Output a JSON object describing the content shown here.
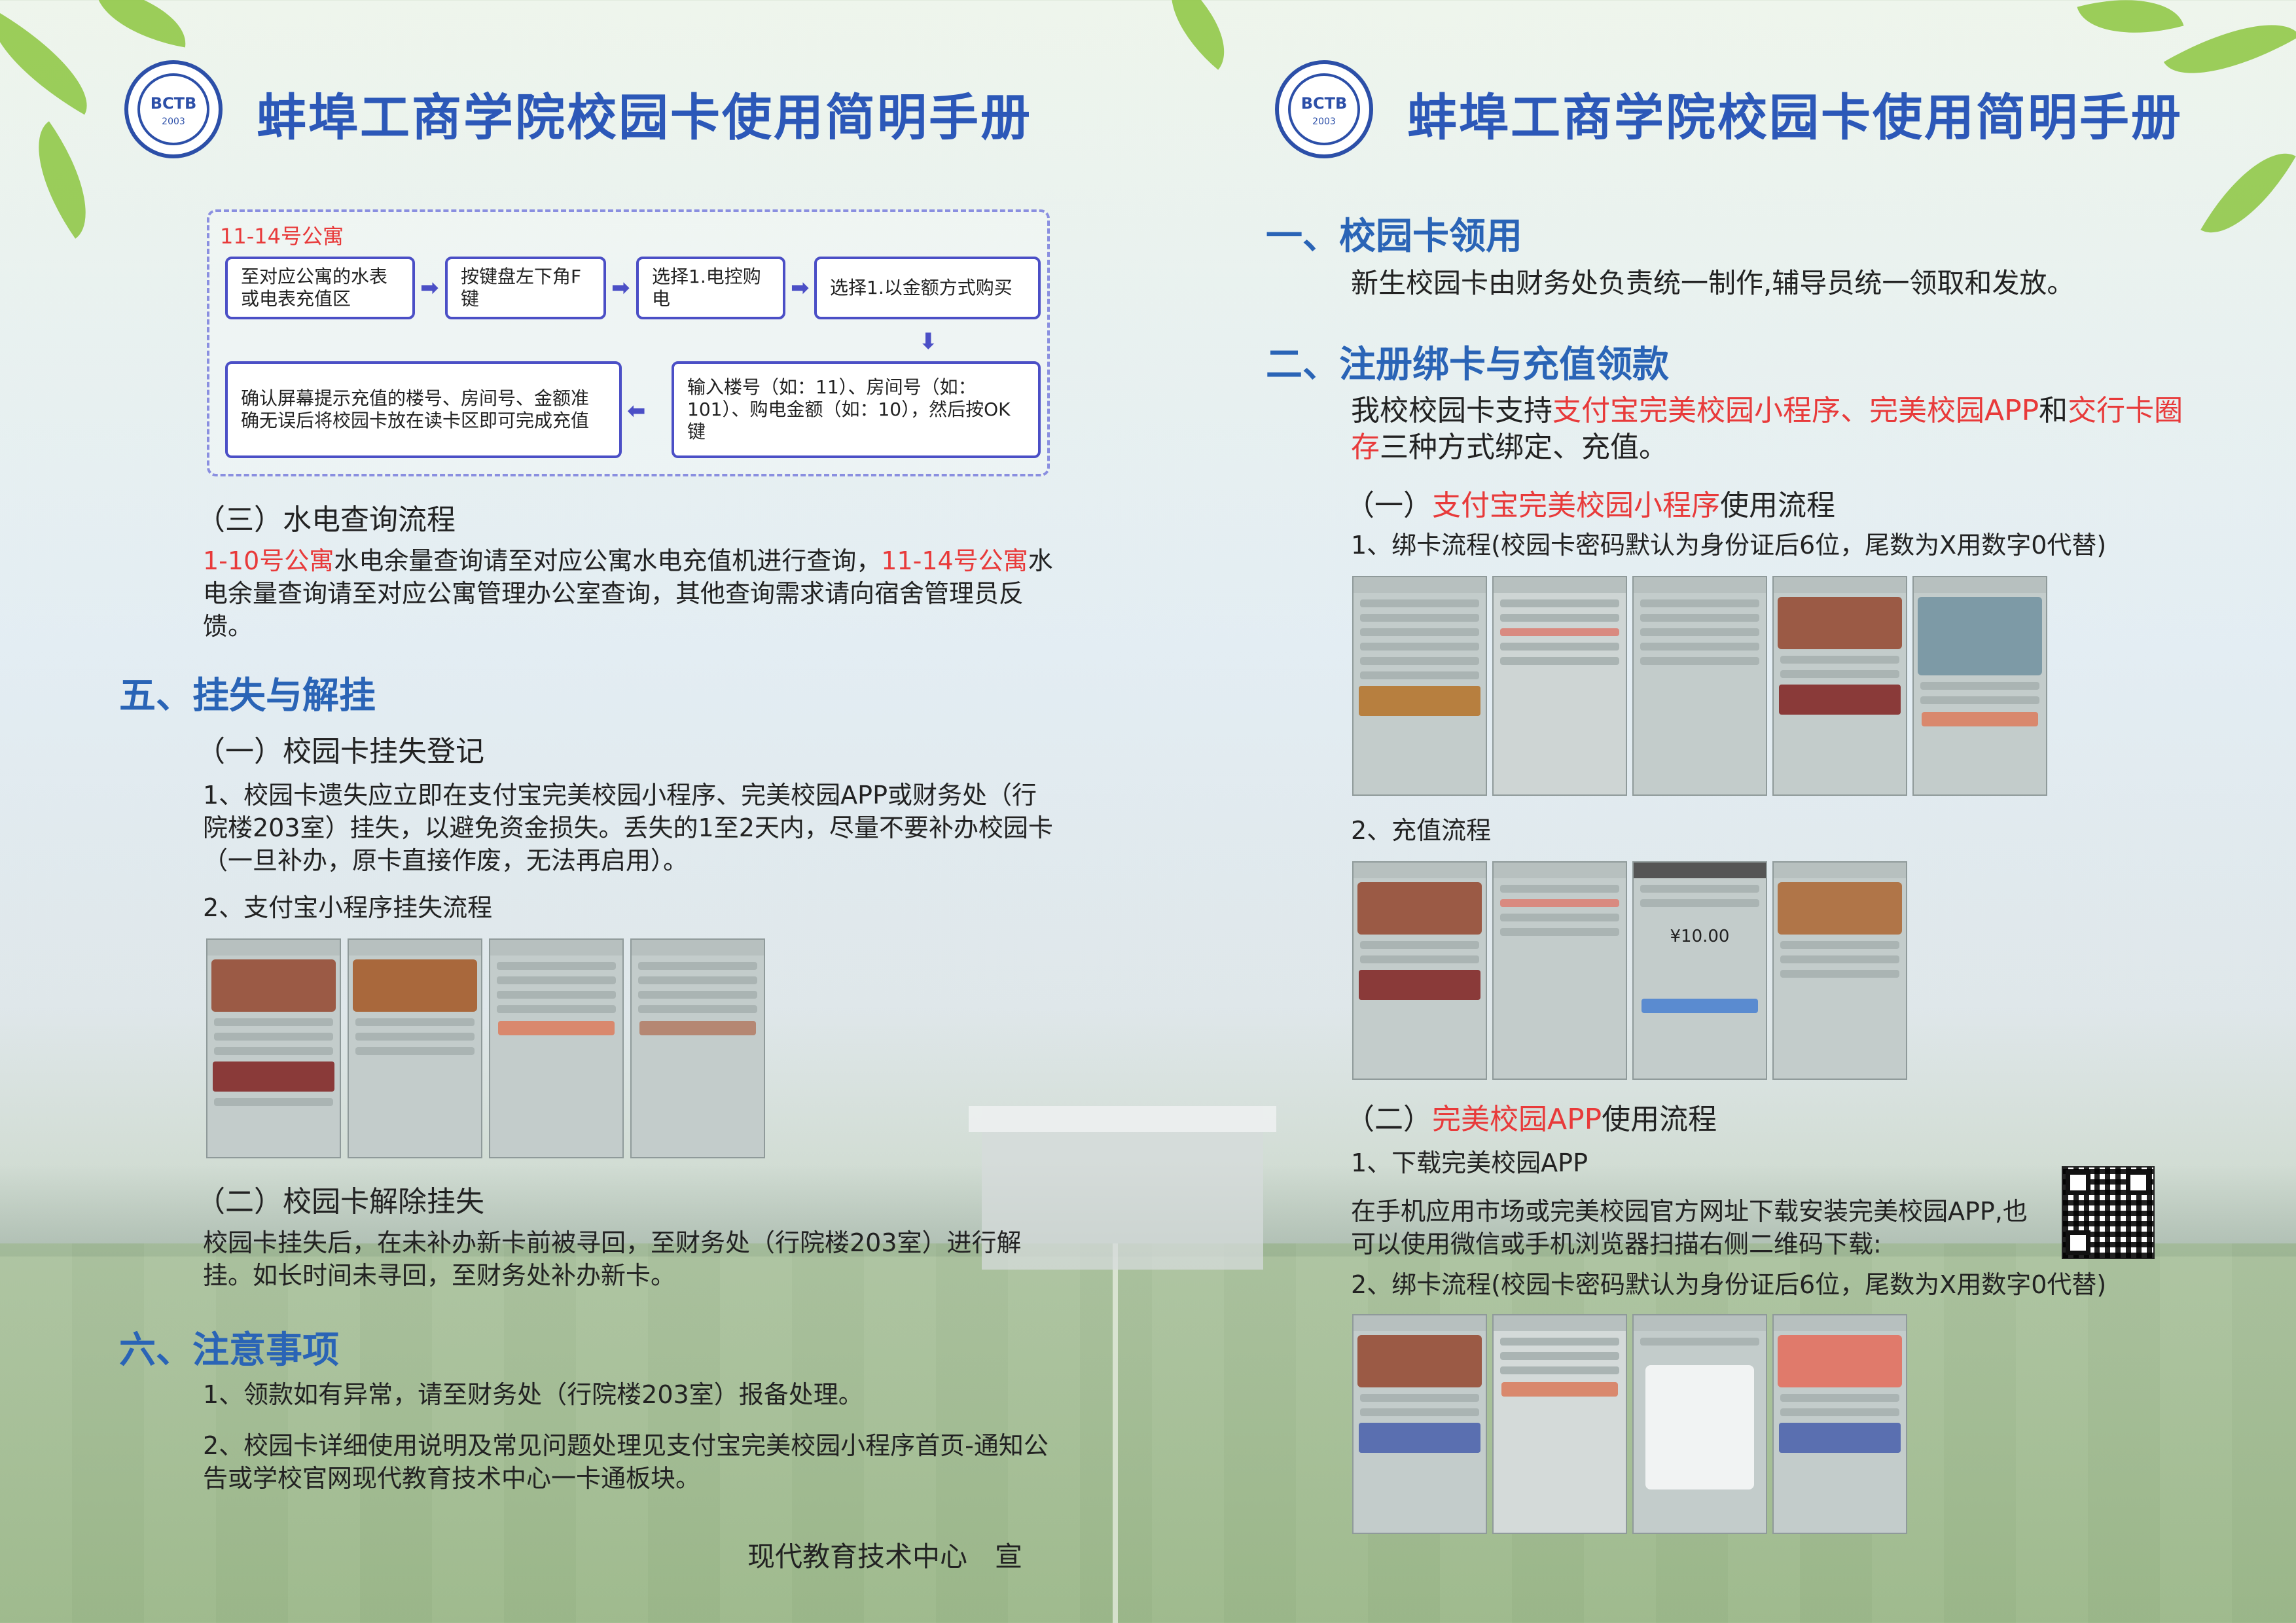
{
  "header": {
    "title": "蚌埠工商学院校园卡使用简明手册",
    "logo_text": "BCTB",
    "logo_year": "2003"
  },
  "left": {
    "flow": {
      "title": "11-14号公寓",
      "steps": [
        "至对应公寓的水表或电表充值区",
        "按键盘左下角F键",
        "选择1.电控购电",
        "选择1.以金额方式购买",
        "输入楼号（如：11）、房间号（如：101）、购电金额（如：10），然后按OK键",
        "确认屏幕提示充值的楼号、房间号、金额准确无误后将校园卡放在读卡区即可完成充值"
      ]
    },
    "s3_title": "（三）水电查询流程",
    "s3_red1": "1-10号公寓",
    "s3_text1": "水电余量查询请至对应公寓水电充值机进行查询，",
    "s3_red2": "11-14号公寓",
    "s3_text2": "水电余量查询请至对应公寓管理办公室查询，其他查询需求请向宿舍管理员反馈。",
    "s5_title": "五、挂失与解挂",
    "s5_sub1": "（一）校园卡挂失登记",
    "s5_p1": "1、校园卡遗失应立即在支付宝完美校园小程序、完美校园APP或财务处（行院楼203室）挂失，以避免资金损失。丢失的1至2天内，尽量不要补办校园卡（一旦补办，原卡直接作废，无法再启用）。",
    "s5_p2": "2、支付宝小程序挂失流程",
    "s5_sub2": "（二）校园卡解除挂失",
    "s5_p3": "校园卡挂失后，在未补办新卡前被寻回，至财务处（行院楼203室）进行解挂。如长时间未寻回，至财务处补办新卡。",
    "s6_title": "六、注意事项",
    "s6_p1": "1、领款如有异常，请至财务处（行院楼203室）报备处理。",
    "s6_p2": "2、校园卡详细使用说明及常见问题处理见支付宝完美校园小程序首页-通知公告或学校官网现代教育技术中心一卡通板块。",
    "sign": "现代教育技术中心　宣"
  },
  "right": {
    "s1_title": "一、校园卡领用",
    "s1_p": "新生校园卡由财务处负责统一制作,辅导员统一领取和发放。",
    "s2_title": "二、注册绑卡与充值领款",
    "s2_a": "我校校园卡支持",
    "s2_red1": "支付宝完美校园小程序、完美校园APP",
    "s2_b": "和",
    "s2_red2": "交行卡圈存",
    "s2_c": "三种方式绑定、充值。",
    "sub1_a": "（一）",
    "sub1_red": "支付宝完美校园小程序",
    "sub1_b": "使用流程",
    "bind1": "1、绑卡流程(校园卡密码默认为身份证后6位，尾数为X用数字0代替)",
    "recharge": "2、充值流程",
    "recharge_amount": "¥10.00",
    "sub2_a": "（二）",
    "sub2_red": "完美校园APP",
    "sub2_b": "使用流程",
    "download": "1、下载完美校园APP",
    "download_desc": "在手机应用市场或完美校园官方网址下载安装完美校园APP,也可以使用微信或手机浏览器扫描右侧二维码下载:",
    "bind2": "2、绑卡流程(校园卡密码默认为身份证后6位，尾数为X用数字0代替)"
  },
  "colors": {
    "heading_blue": "#2a64b6",
    "accent_red": "#e83a3a",
    "flow_border": "#4b4fc6"
  }
}
